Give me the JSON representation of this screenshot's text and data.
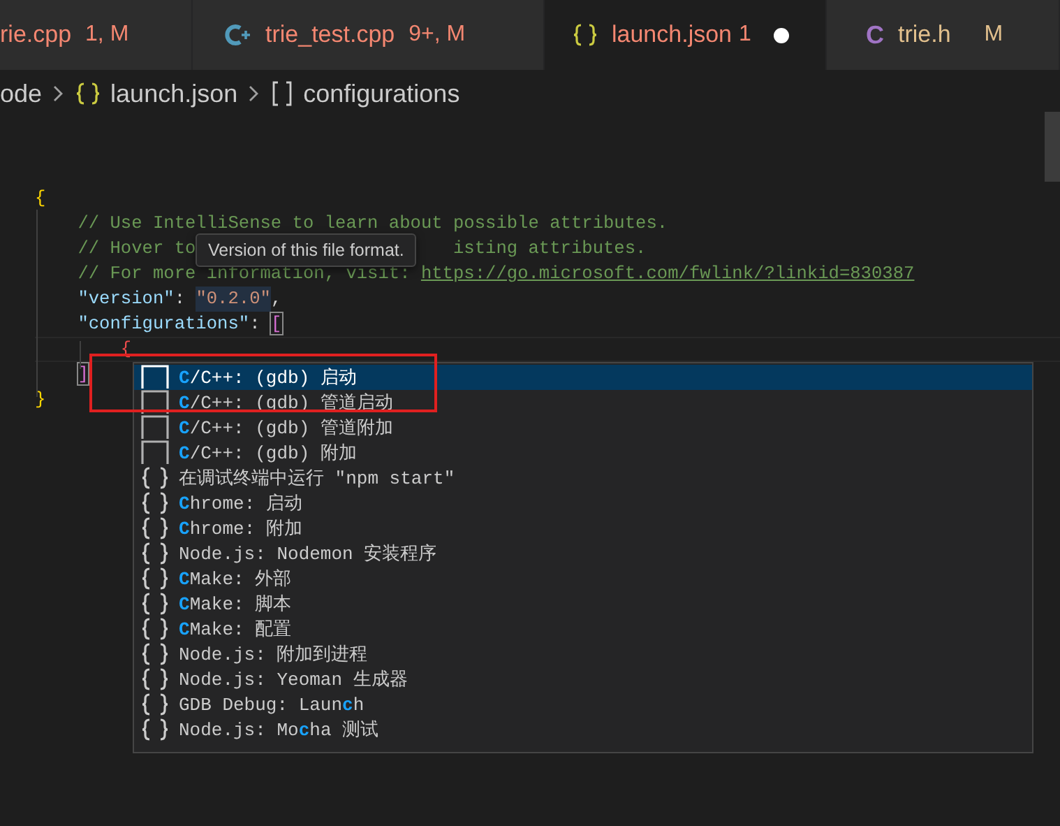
{
  "tabs": [
    {
      "label": "rie.cpp",
      "badge": "1, M",
      "has_errors": true,
      "kind": "plain",
      "selected": false,
      "dirty": false
    },
    {
      "label": "trie_test.cpp",
      "badge": "9+, M",
      "has_errors": true,
      "kind": "cpp",
      "selected": false,
      "dirty": false
    },
    {
      "label": "launch.json",
      "badge": "1",
      "has_errors": true,
      "kind": "json",
      "selected": true,
      "dirty": true
    },
    {
      "label": "trie.h",
      "badge": "M",
      "has_errors": false,
      "kind": "c",
      "icon_text": "C",
      "selected": false,
      "dirty": false
    }
  ],
  "breadcrumb": [
    {
      "label": "ode",
      "kind": "plain"
    },
    {
      "label": "launch.json",
      "kind": "json"
    },
    {
      "label": "configurations",
      "kind": "array"
    }
  ],
  "code_lines": [
    {
      "tokens": [
        {
          "kind": "brace",
          "text": "{"
        }
      ]
    },
    {
      "tokens": [
        {
          "kind": "comment",
          "text": "    // Use IntelliSense to learn about possible attributes."
        }
      ]
    },
    {
      "tokens": [
        {
          "kind": "comment",
          "text": "    // Hover to "
        },
        {
          "kind": "comment",
          "text": "isting attributes.",
          "after_tooltip": true
        }
      ]
    },
    {
      "tokens": [
        {
          "kind": "comment",
          "text": "    // For more information, visit: "
        },
        {
          "kind": "link",
          "text": "https://go.microsoft.com/fwlink/?linkid=830387"
        }
      ]
    },
    {
      "tokens": [
        {
          "kind": "key",
          "text": "    \"version\""
        },
        {
          "kind": "punct",
          "text": ": "
        },
        {
          "kind": "string",
          "text": "\"0.2.0\"",
          "highlighted": true
        },
        {
          "kind": "punct",
          "text": ","
        }
      ]
    },
    {
      "tokens": [
        {
          "kind": "key",
          "text": "    \"configurations\""
        },
        {
          "kind": "punct",
          "text": ": "
        },
        {
          "kind": "bracket",
          "text": "[",
          "matched": true
        }
      ]
    },
    {
      "tokens": [
        {
          "kind": "error",
          "text": "        {"
        }
      ],
      "current": true
    },
    {
      "tokens": [
        {
          "kind": "bracket",
          "text": "    ]",
          "matched": true
        }
      ]
    },
    {
      "tokens": [
        {
          "kind": "brace",
          "text": "}"
        }
      ]
    }
  ],
  "tooltip": {
    "text": "Version of this file format."
  },
  "suggestions": [
    {
      "kind": "snippet",
      "selected": true,
      "parts": [
        {
          "text": "C",
          "match": true
        },
        {
          "text": "/C++: (gdb) 启动",
          "match": false
        }
      ]
    },
    {
      "kind": "snippet",
      "selected": false,
      "parts": [
        {
          "text": "C",
          "match": true
        },
        {
          "text": "/C++: (gdb) 管道启动",
          "match": false
        }
      ]
    },
    {
      "kind": "snippet",
      "selected": false,
      "parts": [
        {
          "text": "C",
          "match": true
        },
        {
          "text": "/C++: (gdb) 管道附加",
          "match": false
        }
      ]
    },
    {
      "kind": "snippet",
      "selected": false,
      "parts": [
        {
          "text": "C",
          "match": true
        },
        {
          "text": "/C++: (gdb) 附加",
          "match": false
        }
      ]
    },
    {
      "kind": "braces",
      "selected": false,
      "parts": [
        {
          "text": "在调试终端中运行 \"npm start\"",
          "match": false
        }
      ]
    },
    {
      "kind": "braces",
      "selected": false,
      "parts": [
        {
          "text": "C",
          "match": true
        },
        {
          "text": "hrome: 启动",
          "match": false
        }
      ]
    },
    {
      "kind": "braces",
      "selected": false,
      "parts": [
        {
          "text": "C",
          "match": true
        },
        {
          "text": "hrome: 附加",
          "match": false
        }
      ]
    },
    {
      "kind": "braces",
      "selected": false,
      "parts": [
        {
          "text": "Node.js: Nodemon 安装程序",
          "match": false
        }
      ]
    },
    {
      "kind": "braces",
      "selected": false,
      "parts": [
        {
          "text": "C",
          "match": true
        },
        {
          "text": "Make: 外部",
          "match": false
        }
      ]
    },
    {
      "kind": "braces",
      "selected": false,
      "parts": [
        {
          "text": "C",
          "match": true
        },
        {
          "text": "Make: 脚本",
          "match": false
        }
      ]
    },
    {
      "kind": "braces",
      "selected": false,
      "parts": [
        {
          "text": "C",
          "match": true
        },
        {
          "text": "Make: 配置",
          "match": false
        }
      ]
    },
    {
      "kind": "braces",
      "selected": false,
      "parts": [
        {
          "text": "Node.js: 附加到进程",
          "match": false
        }
      ]
    },
    {
      "kind": "braces",
      "selected": false,
      "parts": [
        {
          "text": "Node.js: Yeoman 生成器",
          "match": false
        }
      ]
    },
    {
      "kind": "braces",
      "selected": false,
      "parts": [
        {
          "text": "GDB Debug: Laun",
          "match": false
        },
        {
          "text": "c",
          "match": true
        },
        {
          "text": "h",
          "match": false
        }
      ]
    },
    {
      "kind": "braces",
      "selected": false,
      "parts": [
        {
          "text": "Node.js: Mo",
          "match": false
        },
        {
          "text": "c",
          "match": true
        },
        {
          "text": "ha 测试",
          "match": false
        }
      ]
    }
  ]
}
